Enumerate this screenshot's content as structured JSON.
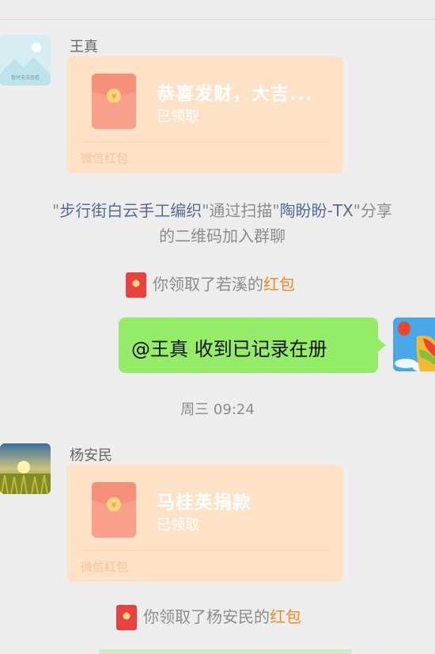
{
  "messages": {
    "msg1": {
      "sender": "王真",
      "redpacket_title": "恭喜发财，大吉...",
      "redpacket_status": "已领取",
      "redpacket_footer": "微信红包",
      "avatar_caption": "暂时无法查看"
    },
    "system1": {
      "quote_open": "\"",
      "joiner": "步行街白云手工编织",
      "via_text": "\"通过扫描\"",
      "sharer": "陶盼盼-TX",
      "share_suffix": "\"分享",
      "line2": "的二维码加入群聊"
    },
    "system2": {
      "prefix": "你领取了若溪的",
      "link": "红包"
    },
    "outgoing": {
      "text": "@王真  收到已记录在册"
    },
    "timestamp": "周三 09:24",
    "msg2": {
      "sender": "杨安民",
      "redpacket_title": "马桂英捐款",
      "redpacket_status": "已领取",
      "redpacket_footer": "微信红包"
    },
    "system3": {
      "prefix": "你领取了杨安民的",
      "link": "红包"
    }
  },
  "colors": {
    "redpacket_bg": "#fde2c7",
    "outgoing_bubble": "#95ec69",
    "link_blue": "#576b95",
    "link_orange": "#f08a24"
  },
  "icons": [
    "image-placeholder-icon",
    "red-packet-icon",
    "hot-air-balloon-avatar",
    "sunset-field-avatar"
  ]
}
